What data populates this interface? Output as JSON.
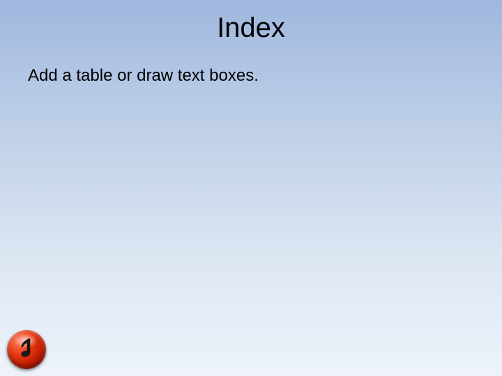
{
  "slide": {
    "title": "Index",
    "body": "Add a table or draw text boxes."
  },
  "icons": {
    "music_note": "music-note-icon"
  }
}
